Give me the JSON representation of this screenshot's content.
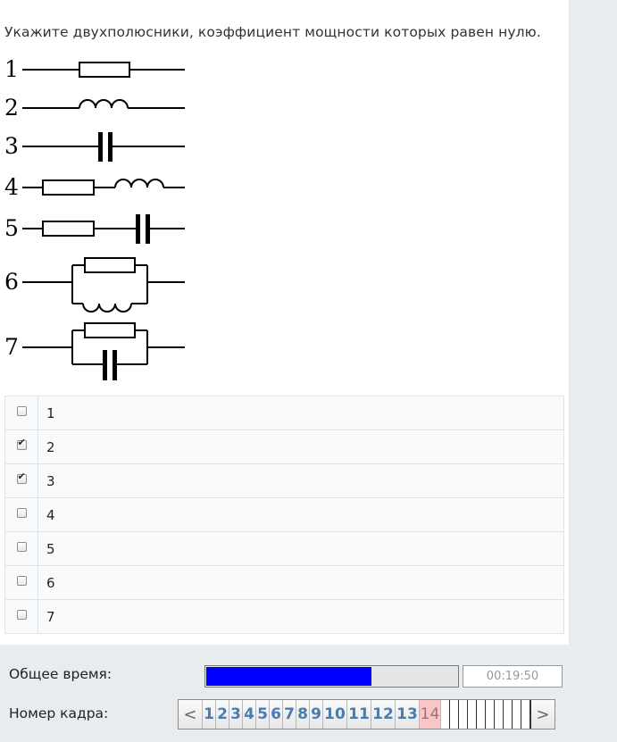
{
  "question": "Укажите двухполюсники, коэффициент мощности которых равен нулю.",
  "diagram_labels": [
    "1",
    "2",
    "3",
    "4",
    "5",
    "6",
    "7"
  ],
  "answers": [
    {
      "label": "1",
      "checked": false
    },
    {
      "label": "2",
      "checked": true
    },
    {
      "label": "3",
      "checked": true
    },
    {
      "label": "4",
      "checked": false
    },
    {
      "label": "5",
      "checked": false
    },
    {
      "label": "6",
      "checked": false
    },
    {
      "label": "7",
      "checked": false
    }
  ],
  "check_mark": "✔",
  "footer": {
    "time_label": "Общее время:",
    "time_value": "00:19:50",
    "time_progress_percent": 66,
    "time_bar_color": "#0000ff",
    "frame_label": "Номер кадра:",
    "prev_arrow": "<",
    "next_arrow": ">",
    "frames": [
      "1",
      "2",
      "3",
      "4",
      "5",
      "6",
      "7",
      "8",
      "9",
      "10",
      "11",
      "12",
      "13",
      "14"
    ],
    "current_frame": "14",
    "empty_frames": 10
  }
}
